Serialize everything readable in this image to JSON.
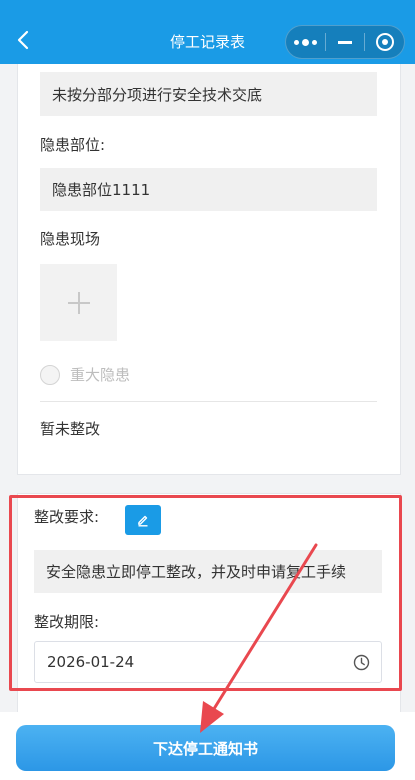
{
  "header": {
    "title": "停工记录表",
    "back_icon": "chevron-left-icon",
    "capsule_icons": [
      "more-dots-icon",
      "minimize-icon",
      "target-icon"
    ],
    "background": "#1a9be6"
  },
  "record": {
    "violation_text": "未按分部分项进行安全技术交底",
    "hazard_location_label": "隐患部位:",
    "hazard_location_value": "隐患部位1111",
    "hazard_photo_label": "隐患现场",
    "major_hazard_label": "重大隐患",
    "rectify_status": "暂未整改"
  },
  "rectification": {
    "requirement_label": "整改要求:",
    "requirement_value": "安全隐患立即停工整改，并及时申请复工手续",
    "deadline_label": "整改期限:",
    "deadline_value": "2026-01-24"
  },
  "footer": {
    "submit_label": "下达停工通知书",
    "accent": "#2c97e6"
  },
  "annotation": {
    "color": "#e9484f"
  }
}
